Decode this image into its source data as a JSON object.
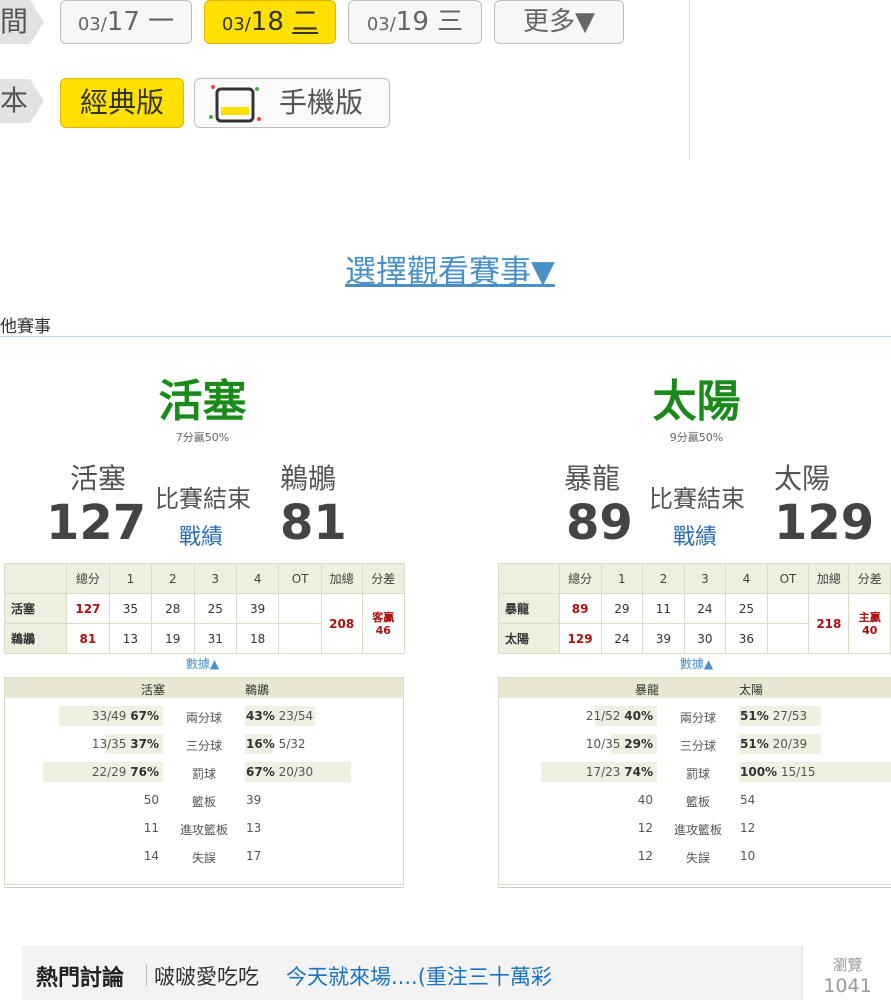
{
  "top": {
    "time_label": "間",
    "dates": [
      {
        "small": "03/",
        "day": "17",
        "weekday": "一",
        "active": false
      },
      {
        "small": "03/",
        "day": "18",
        "weekday": "二",
        "active": true
      },
      {
        "small": "03/",
        "day": "19",
        "weekday": "三",
        "active": false
      }
    ],
    "more_label": "更多▼",
    "version_label": "本",
    "classic_label": "經典版",
    "mobile_label": "手機版"
  },
  "select_game_label": "選擇觀看賽事▼",
  "other_games_label": "他賽事",
  "quarter_headers": [
    "總分",
    "1",
    "2",
    "3",
    "4",
    "OT",
    "加總",
    "分差"
  ],
  "data_link": "數據▲",
  "stat_labels": [
    "兩分球",
    "三分球",
    "罰球",
    "籃板",
    "進攻籃板",
    "失誤"
  ],
  "games": [
    {
      "winner": "活塞",
      "winner_sub": "7分贏50%",
      "away_name": "活塞",
      "home_name": "鵜鶘",
      "away_score": "127",
      "home_score": "81",
      "status": "比賽結束",
      "record_link": "戰績",
      "rows": [
        {
          "team": "活塞",
          "total": "127",
          "q": [
            "35",
            "28",
            "25",
            "39",
            ""
          ]
        },
        {
          "team": "鵜鶘",
          "total": "81",
          "q": [
            "13",
            "19",
            "31",
            "18",
            ""
          ]
        }
      ],
      "sum": "208",
      "diff_label": "客贏",
      "diff_value": "46",
      "stats_away_name": "活塞",
      "stats_home_name": "鵜鶘",
      "stats": [
        {
          "away": "33/49",
          "away_pct": "67%",
          "home_pct": "43%",
          "home": "23/54"
        },
        {
          "away": "13/35",
          "away_pct": "37%",
          "home_pct": "16%",
          "home": "5/32"
        },
        {
          "away": "22/29",
          "away_pct": "76%",
          "home_pct": "67%",
          "home": "20/30"
        },
        {
          "away": "50",
          "away_pct": "",
          "home_pct": "",
          "home": "39"
        },
        {
          "away": "11",
          "away_pct": "",
          "home_pct": "",
          "home": "13"
        },
        {
          "away": "14",
          "away_pct": "",
          "home_pct": "",
          "home": "17"
        }
      ]
    },
    {
      "winner": "太陽",
      "winner_sub": "9分贏50%",
      "away_name": "暴龍",
      "home_name": "太陽",
      "away_score": "89",
      "home_score": "129",
      "status": "比賽結束",
      "record_link": "戰績",
      "rows": [
        {
          "team": "暴龍",
          "total": "89",
          "q": [
            "29",
            "11",
            "24",
            "25",
            ""
          ]
        },
        {
          "team": "太陽",
          "total": "129",
          "q": [
            "24",
            "39",
            "30",
            "36",
            ""
          ]
        }
      ],
      "sum": "218",
      "diff_label": "主贏",
      "diff_value": "40",
      "stats_away_name": "暴龍",
      "stats_home_name": "太陽",
      "stats": [
        {
          "away": "21/52",
          "away_pct": "40%",
          "home_pct": "51%",
          "home": "27/53"
        },
        {
          "away": "10/35",
          "away_pct": "29%",
          "home_pct": "51%",
          "home": "20/39"
        },
        {
          "away": "17/23",
          "away_pct": "74%",
          "home_pct": "100%",
          "home": "15/15"
        },
        {
          "away": "40",
          "away_pct": "",
          "home_pct": "",
          "home": "54"
        },
        {
          "away": "12",
          "away_pct": "",
          "home_pct": "",
          "home": "12"
        },
        {
          "away": "12",
          "away_pct": "",
          "home_pct": "",
          "home": "10"
        }
      ]
    }
  ],
  "hot": {
    "title": "熱門討論",
    "user": "啵啵愛吃吃",
    "topic": "今天就來場....(重注三十萬彩",
    "views_label": "瀏覽",
    "views": "1041"
  }
}
